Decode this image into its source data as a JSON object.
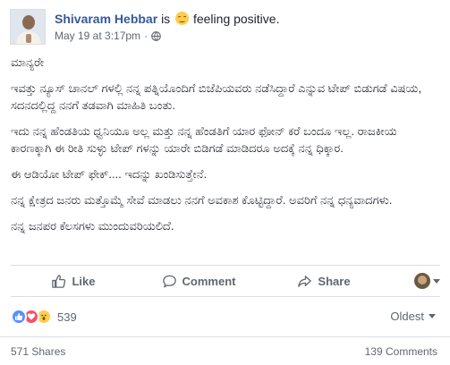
{
  "post": {
    "author": "Shivaram Hebbar",
    "activity_prefix": "is",
    "feeling_emoji": "smiling-face-icon",
    "feeling": "feeling positive.",
    "timestamp": "May 19 at 3:17pm",
    "audience_icon": "globe-icon",
    "paragraphs": [
      "ಮಾನ್ಯರೇ",
      "ಇವತ್ತು ನ್ಯೂಸ್ ಚಾನಲ್ ಗಳಲ್ಲಿ ನನ್ನ ಪತ್ನಿಯೊಂದಿಗೆ ಬಿಜೆಪಿಯವರು ನಡೆಸಿದ್ದಾರೆ ಎನ್ನುವ ಟೇಪ್ ಬಿಡುಗಡೆ ವಿಷಯ, ಸದನದಲ್ಲಿದ್ದ ನನಗೆ ತಡವಾಗಿ ಮಾಹಿತಿ ಬಂತು.",
      "ಇದು ನನ್ನ ಹೆಂಡತಿಯ ಧ್ವನಿಯೂ ಅಲ್ಲ ಮತ್ತು ನನ್ನ ಹೆಂಡತಿಗೆ ಯಾರ ಫೋನ್ ಕರೆ ಬಂದೂ ಇಲ್ಲ. ರಾಜಕೀಯ ಕಾರಣಕ್ಕಾಗಿ ಈ ರೀತಿ ಸುಳ್ಳು ಟೇಪ್ ಗಳನ್ನು ಯಾರೇ ಬಿಡಿಗಡೆ ಮಾಡಿದರೂ ಅದಕ್ಕೆ ನನ್ನ ಧಿಕ್ಕಾರ.",
      "ಈ ಆಡಿಯೋ ಟೇಪ್ ಫೇಕ್.... ಇದನ್ನು ಖಂಡಿಸುತ್ತೇನೆ.",
      "ನನ್ನ ಕ್ಷೇತ್ರದ ಜನರು ಮತ್ತೊಮ್ಮೆ ಸೇವೆ ಮಾಡಲು ನನಗೆ ಅವಕಾಶ ಕೊಟ್ಟಿದ್ದಾರೆ. ಅವರಿಗೆ ನನ್ನ ಧನ್ಯವಾದಗಳು.",
      "ನನ್ನ ಜನಪರ ಕೆಲಸಗಳು ಮುಂದುವರಿಯಲಿದೆ."
    ]
  },
  "actions": {
    "like": "Like",
    "comment": "Comment",
    "share": "Share"
  },
  "reactions": {
    "icons": [
      "like-reaction-icon",
      "love-reaction-icon",
      "wow-reaction-icon"
    ],
    "count": "539"
  },
  "sort": {
    "label": "Oldest"
  },
  "footer": {
    "shares": "571 Shares",
    "comments": "139 Comments"
  },
  "colors": {
    "author": "#365899",
    "like_reaction": "#5890ff",
    "love_reaction": "#f25268",
    "wow_reaction": "#ffcc4d"
  }
}
